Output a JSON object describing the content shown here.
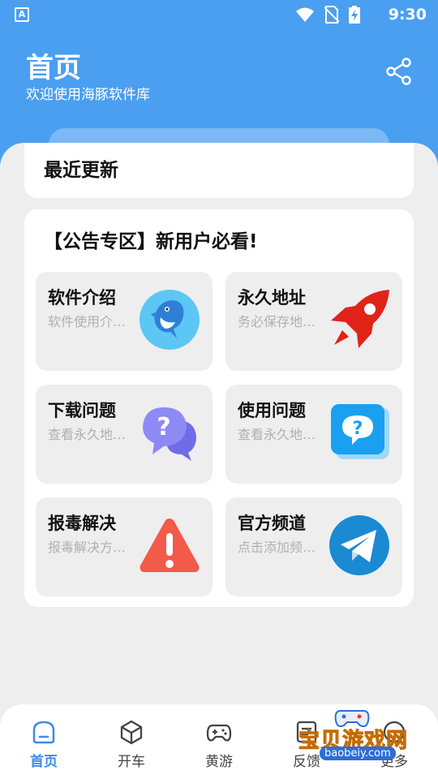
{
  "status_bar": {
    "time": "9:30",
    "app_badge": "A"
  },
  "header": {
    "title": "首页",
    "subtitle": "欢迎使用海豚软件库",
    "share_icon": "share-icon"
  },
  "recent": {
    "title": "最近更新"
  },
  "notice": {
    "title": "【公告专区】新用户必看!",
    "tiles": [
      {
        "title": "软件介绍",
        "desc": "软件使用介…",
        "icon": "dolphin-icon"
      },
      {
        "title": "永久地址",
        "desc": "务必保存地…",
        "icon": "rocket-icon"
      },
      {
        "title": "下载问题",
        "desc": "查看永久地…",
        "icon": "question-chat-icon"
      },
      {
        "title": "使用问题",
        "desc": "查看永久地…",
        "icon": "question-bubble-icon"
      },
      {
        "title": "报毒解决",
        "desc": "报毒解决方…",
        "icon": "warning-icon"
      },
      {
        "title": "官方频道",
        "desc": "点击添加频…",
        "icon": "telegram-icon"
      }
    ]
  },
  "bottom_nav": {
    "items": [
      {
        "label": "首页",
        "icon": "home-icon",
        "active": true
      },
      {
        "label": "开车",
        "icon": "cube-icon",
        "active": false
      },
      {
        "label": "黄游",
        "icon": "gamepad-icon",
        "active": false
      },
      {
        "label": "反馈",
        "icon": "feedback-icon",
        "active": false
      },
      {
        "label": "更多",
        "icon": "more-icon",
        "active": false
      }
    ]
  },
  "watermark": {
    "text": "宝贝游戏网",
    "url": "baobeiy.com"
  },
  "colors": {
    "accent": "#4a9ff0",
    "active_nav": "#3d8be8",
    "background": "#eeeeee"
  }
}
